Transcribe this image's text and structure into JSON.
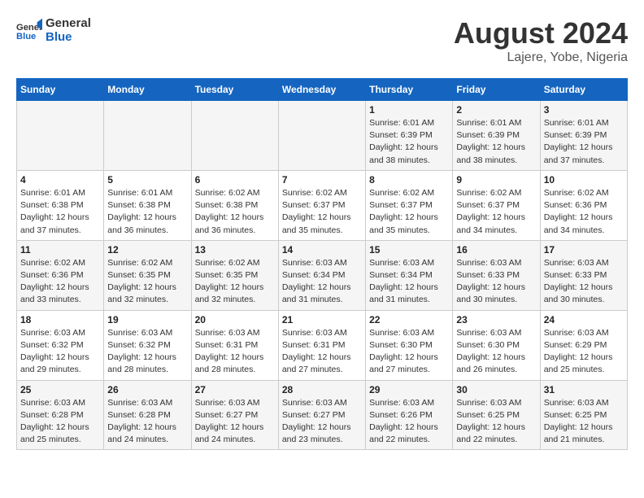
{
  "logo": {
    "line1": "General",
    "line2": "Blue"
  },
  "title": "August 2024",
  "location": "Lajere, Yobe, Nigeria",
  "days_of_week": [
    "Sunday",
    "Monday",
    "Tuesday",
    "Wednesday",
    "Thursday",
    "Friday",
    "Saturday"
  ],
  "weeks": [
    [
      {
        "day": "",
        "detail": ""
      },
      {
        "day": "",
        "detail": ""
      },
      {
        "day": "",
        "detail": ""
      },
      {
        "day": "",
        "detail": ""
      },
      {
        "day": "1",
        "detail": "Sunrise: 6:01 AM\nSunset: 6:39 PM\nDaylight: 12 hours\nand 38 minutes."
      },
      {
        "day": "2",
        "detail": "Sunrise: 6:01 AM\nSunset: 6:39 PM\nDaylight: 12 hours\nand 38 minutes."
      },
      {
        "day": "3",
        "detail": "Sunrise: 6:01 AM\nSunset: 6:39 PM\nDaylight: 12 hours\nand 37 minutes."
      }
    ],
    [
      {
        "day": "4",
        "detail": "Sunrise: 6:01 AM\nSunset: 6:38 PM\nDaylight: 12 hours\nand 37 minutes."
      },
      {
        "day": "5",
        "detail": "Sunrise: 6:01 AM\nSunset: 6:38 PM\nDaylight: 12 hours\nand 36 minutes."
      },
      {
        "day": "6",
        "detail": "Sunrise: 6:02 AM\nSunset: 6:38 PM\nDaylight: 12 hours\nand 36 minutes."
      },
      {
        "day": "7",
        "detail": "Sunrise: 6:02 AM\nSunset: 6:37 PM\nDaylight: 12 hours\nand 35 minutes."
      },
      {
        "day": "8",
        "detail": "Sunrise: 6:02 AM\nSunset: 6:37 PM\nDaylight: 12 hours\nand 35 minutes."
      },
      {
        "day": "9",
        "detail": "Sunrise: 6:02 AM\nSunset: 6:37 PM\nDaylight: 12 hours\nand 34 minutes."
      },
      {
        "day": "10",
        "detail": "Sunrise: 6:02 AM\nSunset: 6:36 PM\nDaylight: 12 hours\nand 34 minutes."
      }
    ],
    [
      {
        "day": "11",
        "detail": "Sunrise: 6:02 AM\nSunset: 6:36 PM\nDaylight: 12 hours\nand 33 minutes."
      },
      {
        "day": "12",
        "detail": "Sunrise: 6:02 AM\nSunset: 6:35 PM\nDaylight: 12 hours\nand 32 minutes."
      },
      {
        "day": "13",
        "detail": "Sunrise: 6:02 AM\nSunset: 6:35 PM\nDaylight: 12 hours\nand 32 minutes."
      },
      {
        "day": "14",
        "detail": "Sunrise: 6:03 AM\nSunset: 6:34 PM\nDaylight: 12 hours\nand 31 minutes."
      },
      {
        "day": "15",
        "detail": "Sunrise: 6:03 AM\nSunset: 6:34 PM\nDaylight: 12 hours\nand 31 minutes."
      },
      {
        "day": "16",
        "detail": "Sunrise: 6:03 AM\nSunset: 6:33 PM\nDaylight: 12 hours\nand 30 minutes."
      },
      {
        "day": "17",
        "detail": "Sunrise: 6:03 AM\nSunset: 6:33 PM\nDaylight: 12 hours\nand 30 minutes."
      }
    ],
    [
      {
        "day": "18",
        "detail": "Sunrise: 6:03 AM\nSunset: 6:32 PM\nDaylight: 12 hours\nand 29 minutes."
      },
      {
        "day": "19",
        "detail": "Sunrise: 6:03 AM\nSunset: 6:32 PM\nDaylight: 12 hours\nand 28 minutes."
      },
      {
        "day": "20",
        "detail": "Sunrise: 6:03 AM\nSunset: 6:31 PM\nDaylight: 12 hours\nand 28 minutes."
      },
      {
        "day": "21",
        "detail": "Sunrise: 6:03 AM\nSunset: 6:31 PM\nDaylight: 12 hours\nand 27 minutes."
      },
      {
        "day": "22",
        "detail": "Sunrise: 6:03 AM\nSunset: 6:30 PM\nDaylight: 12 hours\nand 27 minutes."
      },
      {
        "day": "23",
        "detail": "Sunrise: 6:03 AM\nSunset: 6:30 PM\nDaylight: 12 hours\nand 26 minutes."
      },
      {
        "day": "24",
        "detail": "Sunrise: 6:03 AM\nSunset: 6:29 PM\nDaylight: 12 hours\nand 25 minutes."
      }
    ],
    [
      {
        "day": "25",
        "detail": "Sunrise: 6:03 AM\nSunset: 6:28 PM\nDaylight: 12 hours\nand 25 minutes."
      },
      {
        "day": "26",
        "detail": "Sunrise: 6:03 AM\nSunset: 6:28 PM\nDaylight: 12 hours\nand 24 minutes."
      },
      {
        "day": "27",
        "detail": "Sunrise: 6:03 AM\nSunset: 6:27 PM\nDaylight: 12 hours\nand 24 minutes."
      },
      {
        "day": "28",
        "detail": "Sunrise: 6:03 AM\nSunset: 6:27 PM\nDaylight: 12 hours\nand 23 minutes."
      },
      {
        "day": "29",
        "detail": "Sunrise: 6:03 AM\nSunset: 6:26 PM\nDaylight: 12 hours\nand 22 minutes."
      },
      {
        "day": "30",
        "detail": "Sunrise: 6:03 AM\nSunset: 6:25 PM\nDaylight: 12 hours\nand 22 minutes."
      },
      {
        "day": "31",
        "detail": "Sunrise: 6:03 AM\nSunset: 6:25 PM\nDaylight: 12 hours\nand 21 minutes."
      }
    ]
  ]
}
